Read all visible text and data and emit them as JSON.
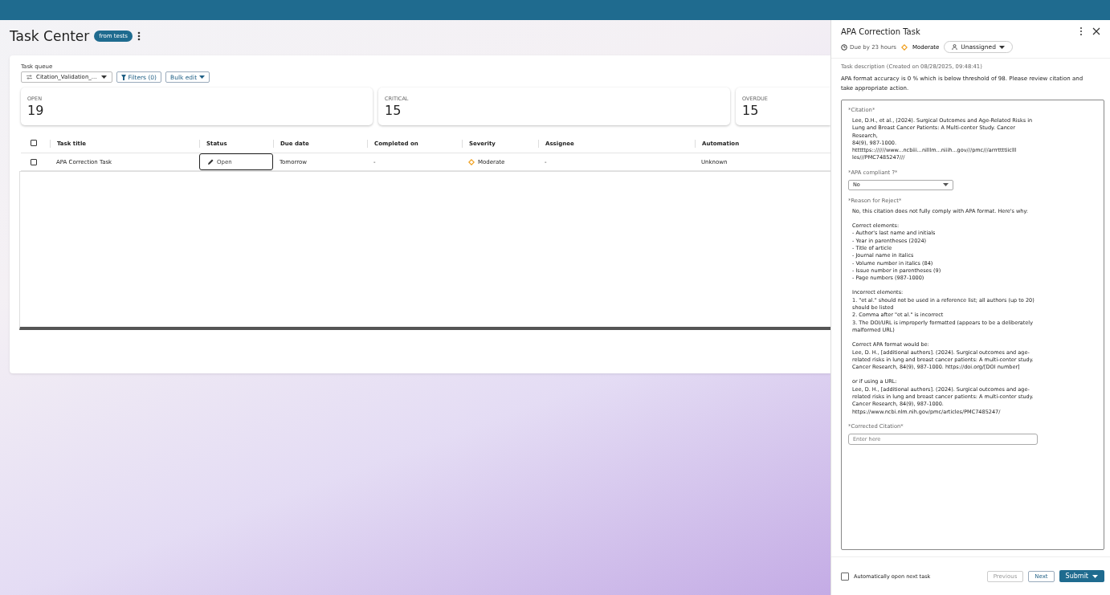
{
  "page": {
    "title": "Task Center",
    "badge": "from tests"
  },
  "task_queue": {
    "label": "Task queue",
    "value": "Citation_Validation_...",
    "filters": "Filters (0)",
    "bulk_edit": "Bulk edit"
  },
  "stats": [
    {
      "label": "OPEN",
      "value": "19"
    },
    {
      "label": "CRITICAL",
      "value": "15"
    },
    {
      "label": "OVERDUE",
      "value": "15"
    }
  ],
  "table": {
    "select_all": false,
    "columns": [
      "Task title",
      "Status",
      "Due date",
      "Completed on",
      "Severity",
      "Assignee",
      "Automation"
    ],
    "rows": [
      {
        "checked": false,
        "title": "APA Correction Task",
        "status": "Open",
        "due": "Tomorrow",
        "completed": "-",
        "severity": "Moderate",
        "assignee": "-",
        "automation": "Unknown"
      }
    ]
  },
  "panel": {
    "title": "APA Correction Task",
    "due": "Due by 23 hours",
    "severity": "Moderate",
    "assignee": "Unassigned",
    "description_label": "Task description (Created on 08/28/2025, 09:48:41)",
    "description": "APA format accuracy is 0 % which is below threshold of 98. Please review citation and take appropriate action.",
    "citation_label": "*Citation*",
    "citation": [
      "Lee, D.H., et al., (2024). Surgical Outcomes and Age-Related Risks in Lung and Breast Cancer Patients: A Multi-center Study. Cancer Research,",
      "84(9), 987-1000.",
      "htttttps:://////www...ncbiii...nilllm...niiih...gov///pmc///arrrttttiiclll",
      "les///PMC7485247///"
    ],
    "compliant_label": "*APA compliant ?*",
    "compliant_value": "No",
    "reason_label": "*Reason for Reject*",
    "reason": [
      "No, this citation does not fully comply with APA format. Here's why:",
      "Correct elements:\n- Author's last name and initials\n- Year in parentheses (2024)\n- Title of article\n- Journal name in italics\n- Volume number in italics (84)\n- Issue number in parentheses (9)\n- Page numbers (987-1000)",
      "Incorrect elements:\n1. \"et al.\" should not be used in a reference list; all authors (up to 20) should be listed\n2. Comma after \"et al.\" is incorrect\n3. The DOI/URL is improperly formatted (appears to be a deliberately malformed URL)",
      "Correct APA format would be:\nLee, D. H., [additional authors]. (2024). Surgical outcomes and age-related risks in lung and breast cancer patients: A multi-center study. Cancer Research, 84(9), 987-1000. https://doi.org/[DOI number]",
      "or if using a URL:\nLee, D. H., [additional authors]. (2024). Surgical outcomes and age-related risks in lung and breast cancer patients: A multi-center study. Cancer Research, 84(9), 987-1000.\nhttps://www.ncbi.nlm.nih.gov/pmc/articles/PMC7485247/"
    ],
    "corrected_label": "*Corrected Citation*",
    "corrected_placeholder": "Enter here",
    "auto_open": {
      "label": "Automatically open next task",
      "checked": false
    },
    "buttons": {
      "previous": {
        "label": "Previous",
        "disabled": true
      },
      "next": {
        "label": "Next",
        "disabled": false
      },
      "submit": "Submit"
    }
  }
}
